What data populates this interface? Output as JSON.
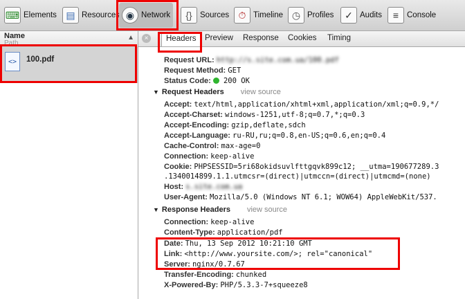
{
  "toolbar": {
    "tabs": [
      {
        "label": "Elements",
        "icon": "elements-icon"
      },
      {
        "label": "Resources",
        "icon": "resources-icon"
      },
      {
        "label": "Network",
        "icon": "network-icon"
      },
      {
        "label": "Sources",
        "icon": "sources-icon"
      },
      {
        "label": "Timeline",
        "icon": "timeline-icon"
      },
      {
        "label": "Profiles",
        "icon": "profiles-icon"
      },
      {
        "label": "Audits",
        "icon": "audits-icon"
      },
      {
        "label": "Console",
        "icon": "console-icon"
      }
    ],
    "selected": "Network"
  },
  "left_panel": {
    "header_name": "Name",
    "header_path": "Path",
    "file_name": "100.pdf"
  },
  "detail_tabs": [
    "Headers",
    "Preview",
    "Response",
    "Cookies",
    "Timing"
  ],
  "general": {
    "request_url_label": "Request URL:",
    "request_url_value": "http://s.site.com.ua/100.pdf",
    "request_method_label": "Request Method:",
    "request_method_value": "GET",
    "status_code_label": "Status Code:",
    "status_code_value": "200 OK"
  },
  "request_headers": {
    "title": "Request Headers",
    "view_source": "view source",
    "items": [
      {
        "k": "Accept:",
        "v": "text/html,application/xhtml+xml,application/xml;q=0.9,*/"
      },
      {
        "k": "Accept-Charset:",
        "v": "windows-1251,utf-8;q=0.7,*;q=0.3"
      },
      {
        "k": "Accept-Encoding:",
        "v": "gzip,deflate,sdch"
      },
      {
        "k": "Accept-Language:",
        "v": "ru-RU,ru;q=0.8,en-US;q=0.6,en;q=0.4"
      },
      {
        "k": "Cache-Control:",
        "v": "max-age=0"
      },
      {
        "k": "Connection:",
        "v": "keep-alive"
      },
      {
        "k": "Cookie:",
        "v": "PHPSESSID=5ri68okidsuvlfttgqvk899c12; __utma=190677289.3"
      },
      {
        "k": "",
        "v": ".1340014899.1.1.utmcsr=(direct)|utmccn=(direct)|utmcmd=(none)"
      },
      {
        "k": "Host:",
        "v": "s.site.com.ua"
      },
      {
        "k": "User-Agent:",
        "v": "Mozilla/5.0 (Windows NT 6.1; WOW64) AppleWebKit/537."
      }
    ]
  },
  "response_headers": {
    "title": "Response Headers",
    "view_source": "view source",
    "items": [
      {
        "k": "Connection:",
        "v": "keep-alive"
      },
      {
        "k": "Content-Type:",
        "v": "application/pdf"
      },
      {
        "k": "Date:",
        "v": "Thu, 13 Sep 2012 10:21:10 GMT"
      },
      {
        "k": "Link:",
        "v": "<http://www.yoursite.com/>; rel=\"canonical\""
      },
      {
        "k": "Server:",
        "v": "nginx/0.7.67"
      },
      {
        "k": "Transfer-Encoding:",
        "v": "chunked"
      },
      {
        "k": "X-Powered-By:",
        "v": "PHP/5.3.3-7+squeeze8"
      }
    ]
  },
  "colors": {
    "highlight": "#e00000",
    "status_ok": "#2fb52f",
    "selected_row": "#d4d4d4"
  }
}
